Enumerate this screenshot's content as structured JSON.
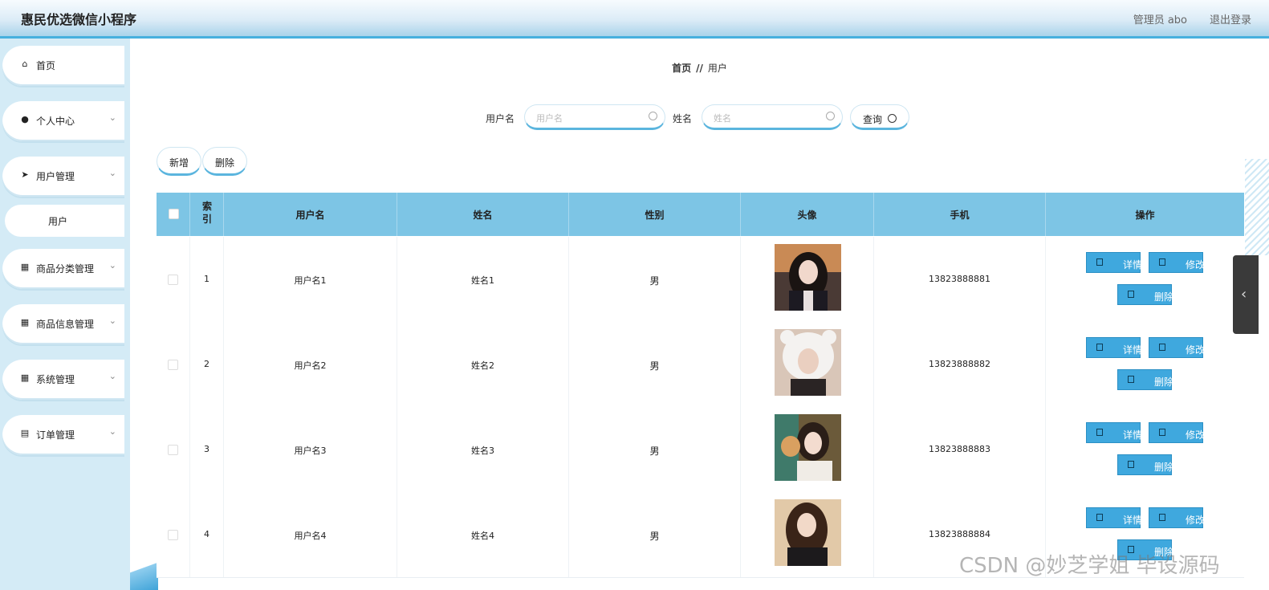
{
  "header": {
    "title": "惠民优选微信小程序",
    "admin": "管理员 abo",
    "logout": "退出登录"
  },
  "sidebar": {
    "items": [
      {
        "label": "首页",
        "icon": "home-icon"
      },
      {
        "label": "个人中心",
        "icon": "user-icon"
      },
      {
        "label": "用户管理",
        "icon": "send-icon"
      },
      {
        "label": "商品分类管理",
        "icon": "grid-icon"
      },
      {
        "label": "商品信息管理",
        "icon": "grid-icon"
      },
      {
        "label": "系统管理",
        "icon": "grid-icon"
      },
      {
        "label": "订单管理",
        "icon": "clipboard-icon"
      }
    ],
    "sub_item": "用户"
  },
  "breadcrumb": {
    "home": "首页",
    "sep": "//",
    "current": "用户"
  },
  "search": {
    "username_label": "用户名",
    "username_placeholder": "用户名",
    "name_label": "姓名",
    "name_placeholder": "姓名",
    "query_label": "查询"
  },
  "toolbar": {
    "add": "新增",
    "delete": "删除"
  },
  "table": {
    "headers": {
      "index": "索引",
      "username": "用户名",
      "name": "姓名",
      "gender": "性别",
      "avatar": "头像",
      "phone": "手机",
      "actions": "操作"
    },
    "rows": [
      {
        "index": "1",
        "username": "用户名1",
        "name": "姓名1",
        "gender": "男",
        "phone": "13823888881"
      },
      {
        "index": "2",
        "username": "用户名2",
        "name": "姓名2",
        "gender": "男",
        "phone": "13823888882"
      },
      {
        "index": "3",
        "username": "用户名3",
        "name": "姓名3",
        "gender": "男",
        "phone": "13823888883"
      },
      {
        "index": "4",
        "username": "用户名4",
        "name": "姓名4",
        "gender": "男",
        "phone": "13823888884"
      }
    ],
    "action_labels": {
      "detail": "详情",
      "edit": "修改",
      "delete": "删除"
    }
  },
  "watermark": "CSDN @妙芝学姐 毕设源码",
  "colors": {
    "accent": "#3fa8de",
    "header_bg": "#7dc5e5",
    "sidebar_bg": "#d4ebf6"
  }
}
